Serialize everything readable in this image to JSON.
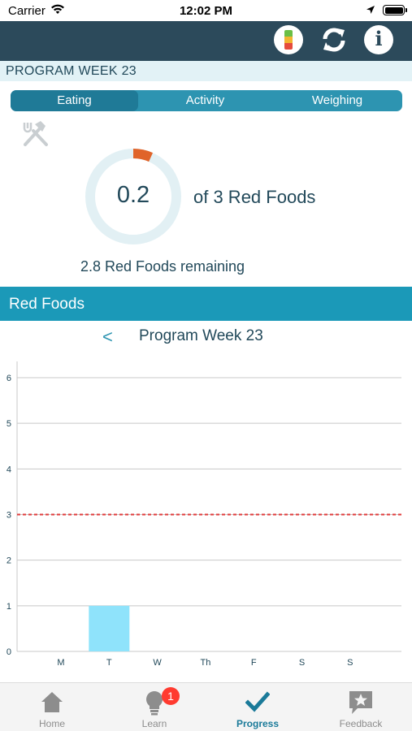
{
  "status_bar": {
    "carrier": "Carrier",
    "time": "12:02 PM"
  },
  "header": {
    "icons": [
      "traffic-light-icon",
      "refresh-icon",
      "info-icon"
    ],
    "info_glyph": "i",
    "traffic_colors": [
      "#6bbf45",
      "#f2b531",
      "#e54b3c"
    ]
  },
  "program_week_banner": "PROGRAM WEEK 23",
  "tabs": [
    {
      "label": "Eating",
      "selected": true
    },
    {
      "label": "Activity",
      "selected": false
    },
    {
      "label": "Weighing",
      "selected": false
    }
  ],
  "summary": {
    "value": "0.2",
    "target_text": "of 3 Red Foods",
    "remaining_text": "2.8 Red Foods remaining",
    "progress_fraction": 0.0667,
    "progress_color": "#e0642a",
    "track_color": "#e2f0f4"
  },
  "section": {
    "title": "Red Foods"
  },
  "week_nav": {
    "prev_glyph": "<",
    "label": "Program Week 23"
  },
  "chart_data": {
    "type": "bar",
    "categories": [
      "M",
      "T",
      "W",
      "Th",
      "F",
      "S",
      "S"
    ],
    "values": [
      0,
      1,
      0,
      0,
      0,
      0,
      0
    ],
    "ylim": [
      0,
      6
    ],
    "yticks": [
      "0",
      "1",
      "2",
      "3",
      "4",
      "5",
      "6"
    ],
    "target_line": 3,
    "bar_color": "#8fe3fb",
    "target_line_color": "#e03b3b",
    "grid": true
  },
  "tab_bar": {
    "items": [
      {
        "label": "Home",
        "icon": "home-icon",
        "active": false
      },
      {
        "label": "Learn",
        "icon": "lightbulb-icon",
        "active": false,
        "badge": "1"
      },
      {
        "label": "Progress",
        "icon": "checkmark-icon",
        "active": true
      },
      {
        "label": "Feedback",
        "icon": "star-feedback-icon",
        "active": false
      }
    ]
  }
}
